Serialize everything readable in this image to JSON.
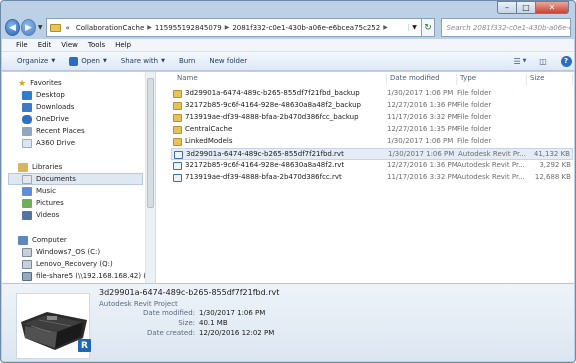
{
  "window": {
    "min_glyph": "–",
    "max_glyph": "□",
    "close_glyph": "✕"
  },
  "address": {
    "overflow": "«",
    "crumbs": [
      "CollaborationCache",
      "1159551928450​79",
      "2081f332-c0e1-430b-a06e-e6bcea75c252"
    ],
    "search_placeholder": "Search 2081f332-c0e1-430b-a06e-e6b..."
  },
  "menu": [
    "File",
    "Edit",
    "View",
    "Tools",
    "Help"
  ],
  "commands": {
    "organize": "Organize",
    "open": "Open",
    "share": "Share with",
    "burn": "Burn",
    "new_folder": "New folder"
  },
  "nav": {
    "favorites": "Favorites",
    "desktop": "Desktop",
    "downloads": "Downloads",
    "onedrive": "OneDrive",
    "recent": "Recent Places",
    "a360": "A360 Drive",
    "libraries": "Libraries",
    "documents": "Documents",
    "music": "Music",
    "pictures": "Pictures",
    "videos": "Videos",
    "computer": "Computer",
    "drive_c": "Windows7_OS (C:)",
    "drive_q": "Lenovo_Recovery (Q:)",
    "drive_z": "file-share5 (\\\\192.168.168.42) (Z:)"
  },
  "columns": {
    "name": "Name",
    "modified": "Date modified",
    "type": "Type",
    "size": "Size"
  },
  "files": [
    {
      "name": "3d29901a-6474-489c-b265-855df7f21fbd_backup",
      "modified": "1/30/2017 1:06 PM",
      "type": "File folder",
      "size": "",
      "kind": "folder"
    },
    {
      "name": "32172b85-9c6f-4164-928e-48630a8a48f2_backup",
      "modified": "12/27/2016 1:36 PM",
      "type": "File folder",
      "size": "",
      "kind": "folder"
    },
    {
      "name": "713919ae-df39-4888-bfaa-2b470d386fcc_backup",
      "modified": "11/17/2016 3:32 PM",
      "type": "File folder",
      "size": "",
      "kind": "folder"
    },
    {
      "name": "CentralCache",
      "modified": "12/27/2016 1:35 PM",
      "type": "File folder",
      "size": "",
      "kind": "folder"
    },
    {
      "name": "LinkedModels",
      "modified": "1/30/2017 1:06 PM",
      "type": "File folder",
      "size": "",
      "kind": "folder"
    },
    {
      "name": "3d29901a-6474-489c-b265-855df7f21fbd.rvt",
      "modified": "1/30/2017 1:06 PM",
      "type": "Autodesk Revit Pr...",
      "size": "41,132 KB",
      "kind": "rvt"
    },
    {
      "name": "32172b85-9c6f-4164-928e-48630a8a48f2.rvt",
      "modified": "12/27/2016 1:36 PM",
      "type": "Autodesk Revit Pr...",
      "size": "3,292 KB",
      "kind": "rvt"
    },
    {
      "name": "713919ae-df39-4888-bfaa-2b470d386fcc.rvt",
      "modified": "11/17/2016 3:32 PM",
      "type": "Autodesk Revit Pr...",
      "size": "12,688 KB",
      "kind": "rvt"
    }
  ],
  "selected_index": 5,
  "details": {
    "title": "3d29901a-6474-489c-b265-855df7f21fbd.rvt",
    "type": "Autodesk Revit Project",
    "modified_label": "Date modified:",
    "modified": "1/30/2017 1:06 PM",
    "size_label": "Size:",
    "size": "40.1 MB",
    "created_label": "Date created:",
    "created": "12/20/2016 12:02 PM",
    "badge": "R"
  }
}
